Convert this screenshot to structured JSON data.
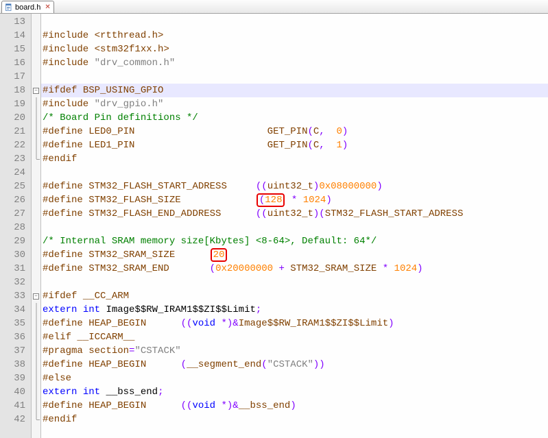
{
  "tab": {
    "filename": "board.h",
    "close_symbol": "✕"
  },
  "gutter": {
    "start": 13,
    "end": 42
  },
  "code_lines": [
    {
      "n": 13,
      "html": ""
    },
    {
      "n": 14,
      "html": "<span class='pp'>#include</span> <span class='pp'>&lt;rtthread.h&gt;</span>"
    },
    {
      "n": 15,
      "html": "<span class='pp'>#include</span> <span class='pp'>&lt;stm32f1xx.h&gt;</span>"
    },
    {
      "n": 16,
      "html": "<span class='pp'>#include</span> <span class='str'>\"drv_common.h\"</span>"
    },
    {
      "n": 17,
      "html": ""
    },
    {
      "n": 18,
      "html": "<span class='pp'>#ifdef</span> <span class='pp'>BSP_USING_GPIO</span>",
      "hl": true,
      "fold": "start"
    },
    {
      "n": 19,
      "html": "<span class='pp'>#include</span> <span class='str'>\"drv_gpio.h\"</span>",
      "fold": "mid"
    },
    {
      "n": 20,
      "html": "<span class='cmt'>/* Board Pin definitions */</span>",
      "fold": "mid"
    },
    {
      "n": 21,
      "html": "<span class='pp'>#define</span> <span class='pp'>LED0_PIN</span>                       <span class='pp'>GET_PIN</span><span class='op'>(</span><span class='pp'>C</span><span class='op'>,</span>  <span class='num'>0</span><span class='op'>)</span>",
      "fold": "mid"
    },
    {
      "n": 22,
      "html": "<span class='pp'>#define</span> <span class='pp'>LED1_PIN</span>                       <span class='pp'>GET_PIN</span><span class='op'>(</span><span class='pp'>C</span><span class='op'>,</span>  <span class='num'>1</span><span class='op'>)</span>",
      "fold": "mid"
    },
    {
      "n": 23,
      "html": "<span class='pp'>#endif</span>",
      "fold": "end"
    },
    {
      "n": 24,
      "html": ""
    },
    {
      "n": 25,
      "html": "<span class='pp'>#define</span> <span class='pp'>STM32_FLASH_START_ADRESS</span>     <span class='op'>((</span><span class='pp'>uint32_t</span><span class='op'>)</span><span class='num'>0x08000000</span><span class='op'>)</span>"
    },
    {
      "n": 26,
      "html": "<span class='pp'>#define</span> <span class='pp'>STM32_FLASH_SIZE</span>             <span class='redbox'><span class='op'>(</span><span class='num'>128</span></span> <span class='op'>*</span> <span class='num'>1024</span><span class='op'>)</span>"
    },
    {
      "n": 27,
      "html": "<span class='pp'>#define</span> <span class='pp'>STM32_FLASH_END_ADDRESS</span>      <span class='op'>((</span><span class='pp'>uint32_t</span><span class='op'>)(</span><span class='pp'>STM32_FLASH_START_ADRESS</span>"
    },
    {
      "n": 28,
      "html": ""
    },
    {
      "n": 29,
      "html": "<span class='cmt'>/* Internal SRAM memory size[Kbytes] &lt;8-64&gt;, Default: 64*/</span>"
    },
    {
      "n": 30,
      "html": "<span class='pp'>#define</span> <span class='pp'>STM32_SRAM_SIZE</span>      <span class='redbox'><span class='num'>20</span></span>"
    },
    {
      "n": 31,
      "html": "<span class='pp'>#define</span> <span class='pp'>STM32_SRAM_END</span>       <span class='op'>(</span><span class='num'>0x20000000</span> <span class='op'>+</span> <span class='pp'>STM32_SRAM_SIZE</span> <span class='op'>*</span> <span class='num'>1024</span><span class='op'>)</span>"
    },
    {
      "n": 32,
      "html": ""
    },
    {
      "n": 33,
      "html": "<span class='pp'>#ifdef</span> <span class='pp'>__CC_ARM</span>",
      "fold": "start"
    },
    {
      "n": 34,
      "html": "<span class='kw'>extern</span> <span class='kw'>int</span> <span class='txt'>Image$$RW_IRAM1$$ZI$$Limit</span><span class='op'>;</span>",
      "fold": "mid"
    },
    {
      "n": 35,
      "html": "<span class='pp'>#define</span> <span class='pp'>HEAP_BEGIN</span>      <span class='op'>((</span><span class='kw'>void</span> <span class='op'>*)&amp;</span><span class='pp'>Image$$RW_IRAM1$$ZI$$Limit</span><span class='op'>)</span>",
      "fold": "mid"
    },
    {
      "n": 36,
      "html": "<span class='pp'>#elif</span> <span class='pp'>__ICCARM__</span>",
      "fold": "mid"
    },
    {
      "n": 37,
      "html": "<span class='pp'>#pragma</span> <span class='pp'>section</span><span class='op'>=</span><span class='str'>\"CSTACK\"</span>",
      "fold": "mid"
    },
    {
      "n": 38,
      "html": "<span class='pp'>#define</span> <span class='pp'>HEAP_BEGIN</span>      <span class='op'>(</span><span class='pp'>__segment_end</span><span class='op'>(</span><span class='str'>\"CSTACK\"</span><span class='op'>))</span>",
      "fold": "mid"
    },
    {
      "n": 39,
      "html": "<span class='pp'>#else</span>",
      "fold": "mid"
    },
    {
      "n": 40,
      "html": "<span class='kw'>extern</span> <span class='kw'>int</span> <span class='txt'>__bss_end</span><span class='op'>;</span>",
      "fold": "mid"
    },
    {
      "n": 41,
      "html": "<span class='pp'>#define</span> <span class='pp'>HEAP_BEGIN</span>      <span class='op'>((</span><span class='kw'>void</span> <span class='op'>*)&amp;</span><span class='pp'>__bss_end</span><span class='op'>)</span>",
      "fold": "mid"
    },
    {
      "n": 42,
      "html": "<span class='pp'>#endif</span>",
      "fold": "end"
    }
  ]
}
